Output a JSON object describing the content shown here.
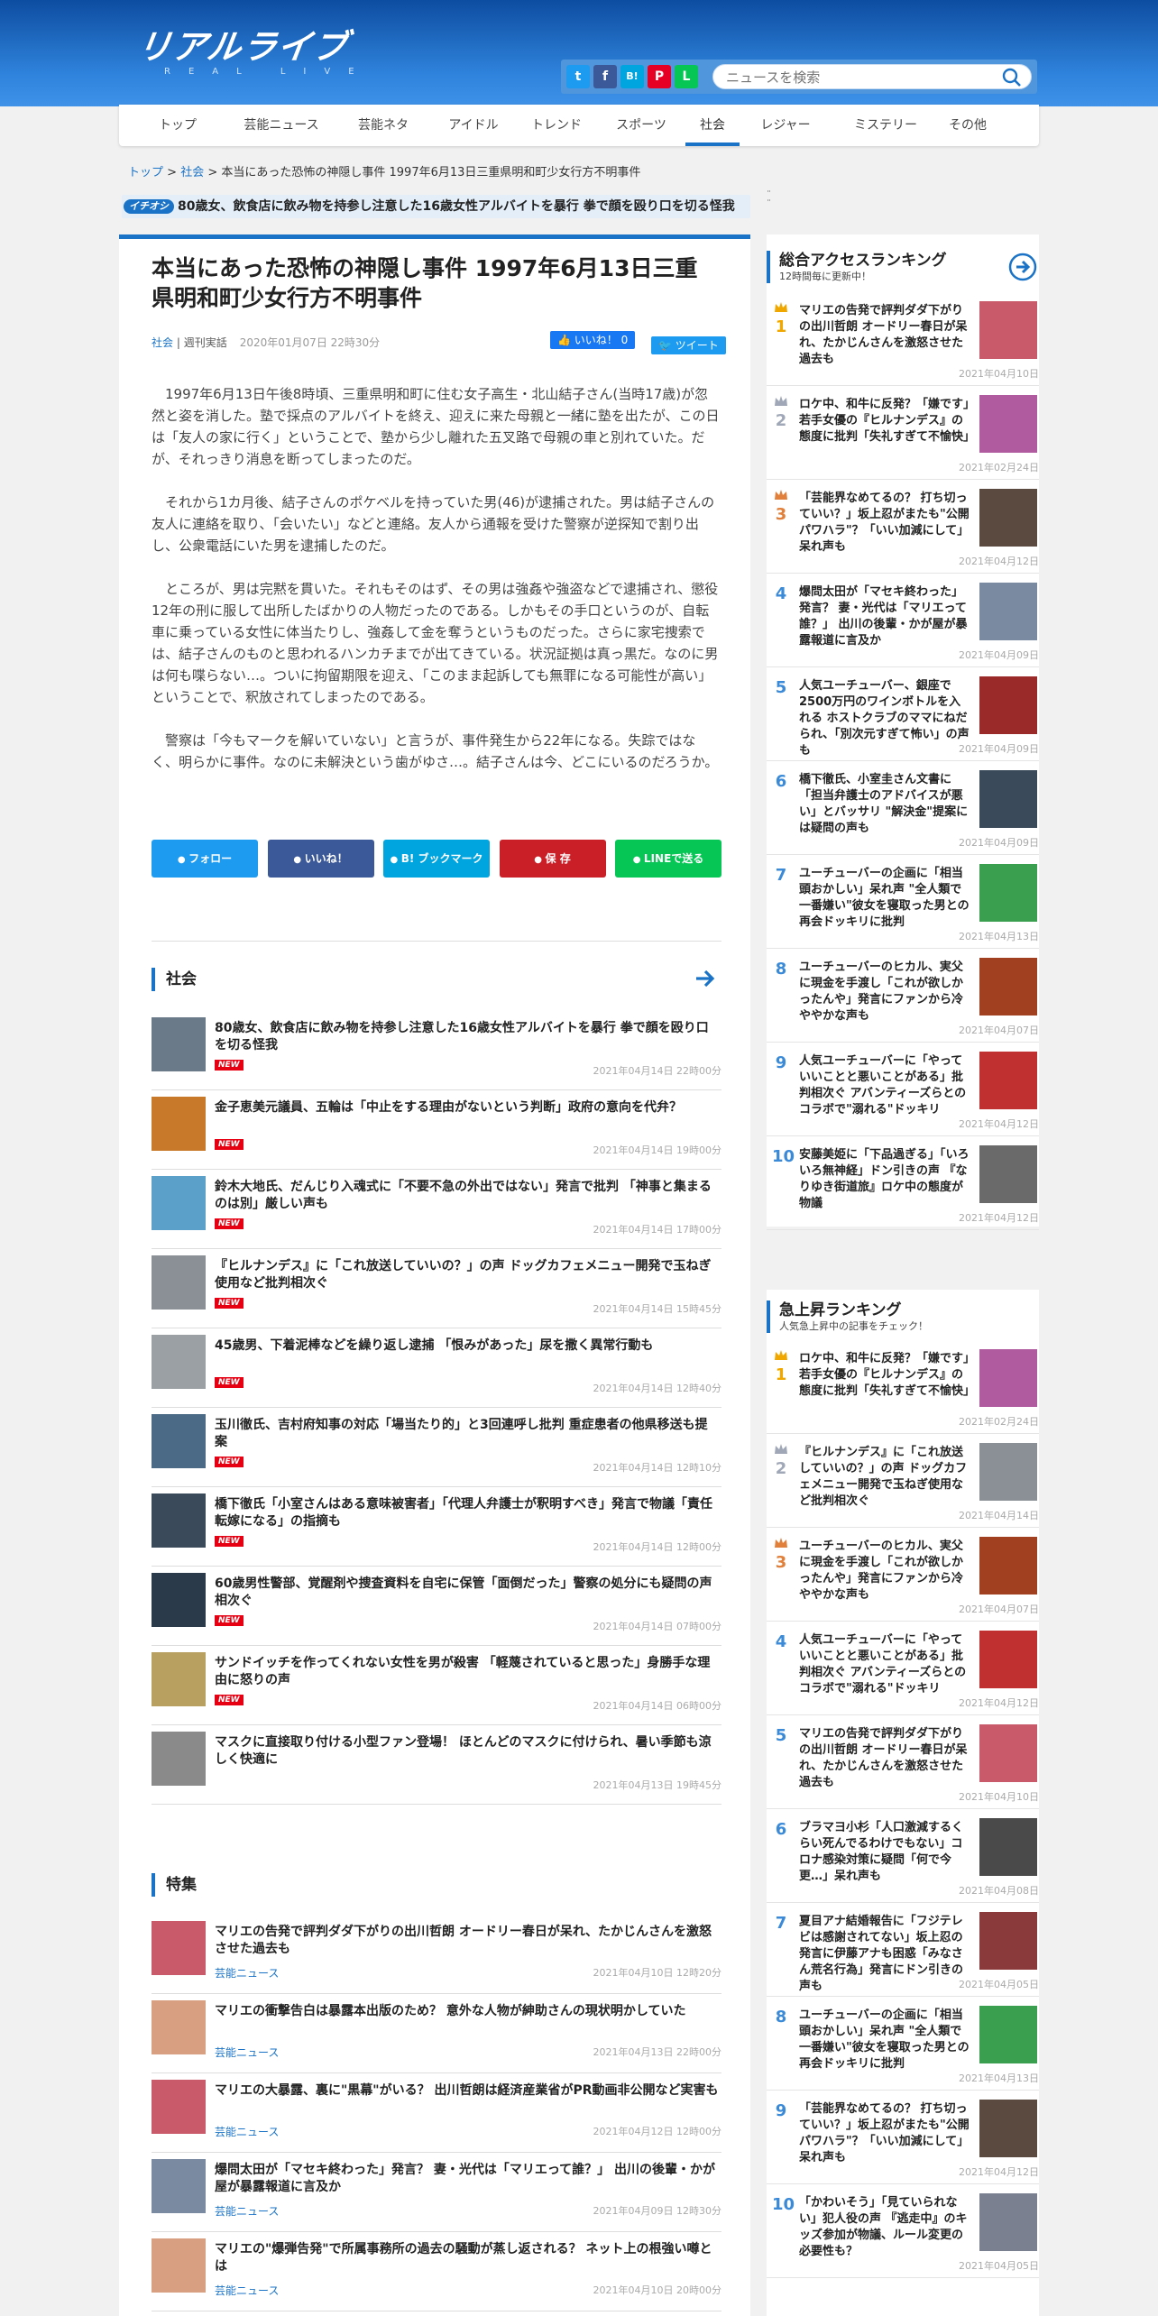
{
  "site": {
    "logo": "リアルライブ",
    "logo_sub": "REAL LIVE",
    "search_placeholder": "ニュースを検索"
  },
  "share_icons": [
    {
      "name": "twitter-icon",
      "glyph": "t",
      "color": "#1d9bf0"
    },
    {
      "name": "facebook-icon",
      "glyph": "f",
      "color": "#3b5998"
    },
    {
      "name": "hatena-icon",
      "glyph": "B!",
      "color": "#00a4de"
    },
    {
      "name": "pinterest-icon",
      "glyph": "P",
      "color": "#e60023"
    },
    {
      "name": "line-icon",
      "glyph": "L",
      "color": "#06c755"
    }
  ],
  "nav": [
    "トップ",
    "芸能ニュース",
    "芸能ネタ",
    "アイドル",
    "トレンド",
    "スポーツ",
    "社会",
    "レジャー",
    "ミステリー",
    "その他"
  ],
  "nav_active": "社会",
  "breadcrumb": {
    "home": "トップ",
    "sep": " > ",
    "cat": "社会",
    "current": "本当にあった恐怖の神隠し事件 1997年6月13日三重県明和町少女行方不明事件"
  },
  "pickup": {
    "tag": "イチオシ",
    "text": "80歳女、飲食店に飲み物を持参し注意した16歳女性アルバイトを暴行 拳で顔を殴り口を切る怪我",
    "dots": "¨"
  },
  "article": {
    "title": "本当にあった恐怖の神隠し事件 1997年6月13日三重県明和町少女行方不明事件",
    "category": "社会",
    "sep": "|",
    "author": "週刊実話",
    "date": "2020年01月07日 22時30分",
    "like": "いいね！ 0",
    "tweet": "ツイート",
    "paragraphs": [
      "1997年6月13日午後8時頃、三重県明和町に住む女子高生・北山結子さん(当時17歳)が忽然と姿を消した。塾で採点のアルバイトを終え、迎えに来た母親と一緒に塾を出たが、この日は「友人の家に行く」ということで、塾から少し離れた五叉路で母親の車と別れていた。だが、それっきり消息を断ってしまったのだ。",
      "それから1カ月後、結子さんのポケベルを持っていた男(46)が逮捕された。男は結子さんの友人に連絡を取り、「会いたい」などと連絡。友人から通報を受けた警察が逆探知で割り出し、公衆電話にいた男を逮捕したのだ。",
      "ところが、男は完黙を貫いた。それもそのはず、その男は強姦や強盗などで逮捕され、懲役12年の刑に服して出所したばかりの人物だったのである。しかもその手口というのが、自転車に乗っている女性に体当たりし、強姦して金を奪うというものだった。さらに家宅捜索では、結子さんのものと思われるハンカチまでが出てきている。状況証拠は真っ黒だ。なのに男は何も喋らない…。ついに拘留期限を迎え、「このまま起訴しても無罪になる可能性が高い」ということで、釈放されてしまったのである。",
      "警察は「今もマークを解いていない」と言うが、事件発生から22年になる。失踪ではなく、明らかに事件。なのに未解決という歯がゆさ…。結子さんは今、どこにいるのだろうか。"
    ]
  },
  "share_buttons": [
    {
      "label": "フォロー",
      "color": "#1d9bf0",
      "icon": "twitter-icon"
    },
    {
      "label": "いいね！",
      "color": "#3b5998",
      "icon": "like-icon"
    },
    {
      "label": "B! ブックマーク",
      "color": "#00a4de",
      "icon": "hatena-icon"
    },
    {
      "label": "保 存",
      "color": "#cb1f27",
      "icon": "pinterest-icon"
    },
    {
      "label": "LINEで送る",
      "color": "#06c755",
      "icon": "line-icon"
    }
  ],
  "section_social": {
    "title": "社会",
    "items": [
      {
        "title": "80歳女、飲食店に飲み物を持参し注意した16歳女性アルバイトを暴行 拳で顔を殴り口を切る怪我",
        "new": "NEW",
        "date": "2021年04月14日 22時00分",
        "c": "#6b7a88"
      },
      {
        "title": "金子恵美元議員、五輪は「中止をする理由がないという判断」政府の意向を代弁？",
        "new": "NEW",
        "date": "2021年04月14日 19時00分",
        "c": "#c87a2a"
      },
      {
        "title": "鈴木大地氏、だんじり入魂式に「不要不急の外出ではない」発言で批判 「神事と集まるのは別」厳しい声も",
        "new": "NEW",
        "date": "2021年04月14日 17時00分",
        "c": "#5aa0c8"
      },
      {
        "title": "『ヒルナンデス』に「これ放送していいの？」の声 ドッグカフェメニュー開発で玉ねぎ使用など批判相次ぐ",
        "new": "NEW",
        "date": "2021年04月14日 15時45分",
        "c": "#8a9096"
      },
      {
        "title": "45歳男、下着泥棒などを繰り返し逮捕 「恨みがあった」尿を撒く異常行動も",
        "new": "NEW",
        "date": "2021年04月14日 12時40分",
        "c": "#9aa0a4"
      },
      {
        "title": "玉川徹氏、吉村府知事の対応「場当たり的」と3回連呼し批判 重症患者の他県移送も提案",
        "new": "NEW",
        "date": "2021年04月14日 12時10分",
        "c": "#4a6a86"
      },
      {
        "title": "橋下徹氏「小室さんはある意味被害者」「代理人弁護士が釈明すべき」発言で物議「責任転嫁になる」の指摘も",
        "new": "NEW",
        "date": "2021年04月14日 12時00分",
        "c": "#3a4a5a"
      },
      {
        "title": "60歳男性警部、覚醒剤や捜査資料を自宅に保管「面倒だった」警察の処分にも疑問の声相次ぐ",
        "new": "NEW",
        "date": "2021年04月14日 07時00分",
        "c": "#2a3a4a"
      },
      {
        "title": "サンドイッチを作ってくれない女性を男が殺害 「軽蔑されていると思った」身勝手な理由に怒りの声",
        "new": "NEW",
        "date": "2021年04月14日 06時00分",
        "c": "#b8a060"
      },
      {
        "title": "マスクに直接取り付ける小型ファン登場！ ほとんどのマスクに付けられ、暑い季節も涼しく快適に",
        "new": "",
        "date": "2021年04月13日 19時45分",
        "c": "#8a8a8a"
      }
    ]
  },
  "section_feature": {
    "title": "特集",
    "items": [
      {
        "title": "マリエの告発で評判ダダ下がりの出川哲朗 オードリー春日が呆れ、たかじんさんを激怒させた過去も",
        "cat": "芸能ニュース",
        "date": "2021年04月10日 12時20分",
        "c": "#c85a6a"
      },
      {
        "title": "マリエの衝撃告白は暴露本出版のため？ 意外な人物が紳助さんの現状明かしていた",
        "cat": "芸能ニュース",
        "date": "2021年04月13日 22時00分",
        "c": "#d8a080"
      },
      {
        "title": "マリエの大暴露、裏に\"黒幕\"がいる？ 出川哲朗は経済産業省がPR動画非公開など実害も",
        "cat": "芸能ニュース",
        "date": "2021年04月12日 12時00分",
        "c": "#c85a6a"
      },
      {
        "title": "爆問太田が「マセキ終わった」発言？ 妻・光代は「マリエって誰？」 出川の後輩・かが屋が暴露報道に言及か",
        "cat": "芸能ニュース",
        "date": "2021年04月09日 12時30分",
        "c": "#7a8aa0"
      },
      {
        "title": "マリエの\"爆弾告発\"で所属事務所の過去の騒動が蒸し返される？ ネット上の根強い噂とは",
        "cat": "芸能ニュース",
        "date": "2021年04月10日 20時00分",
        "c": "#d8a080"
      }
    ]
  },
  "ranking_total": {
    "title": "総合アクセスランキング",
    "sub": "12時間毎に更新中！",
    "items": [
      {
        "rank": "1",
        "title": "マリエの告発で評判ダダ下がりの出川哲朗 オードリー春日が呆れ、たかじんさんを激怒させた過去も",
        "date": "2021年04月10日",
        "c": "#c85a6a"
      },
      {
        "rank": "2",
        "title": "ロケ中、和牛に反発？「嫌です」若手女優の『ヒルナンデス』の態度に批判「失礼すぎて不愉快」",
        "date": "2021年02月24日",
        "c": "#b05aa0"
      },
      {
        "rank": "3",
        "title": "「芸能界なめてるの？ 打ち切っていい？」坂上忍がまたも\"公開パワハラ\"？「いい加減にして」呆れ声も",
        "date": "2021年04月12日",
        "c": "#5a4a40"
      },
      {
        "rank": "4",
        "title": "爆問太田が「マセキ終わった」発言？ 妻・光代は「マリエって誰？」 出川の後輩・かが屋が暴露報道に言及か",
        "date": "2021年04月09日",
        "c": "#7a8aa0"
      },
      {
        "rank": "5",
        "title": "人気ユーチューバー、銀座で2500万円のワインボトルを入れる ホストクラブのママにねだられ、「別次元すぎて怖い」の声も",
        "date": "2021年04月09日",
        "c": "#9a2a2a"
      },
      {
        "rank": "6",
        "title": "橋下徹氏、小室圭さん文書に「担当弁護士のアドバイスが悪い」とバッサリ \"解決金\"提案には疑問の声も",
        "date": "2021年04月09日",
        "c": "#3a4a5a"
      },
      {
        "rank": "7",
        "title": "ユーチューバーの企画に「相当頭おかしい」呆れ声 \"全人類で一番嫌い\"彼女を寝取った男との再会ドッキリに批判",
        "date": "2021年04月13日",
        "c": "#3aa050"
      },
      {
        "rank": "8",
        "title": "ユーチューバーのヒカル、実父に現金を手渡し「これが欲しかったんや」発言にファンから冷ややかな声も",
        "date": "2021年04月07日",
        "c": "#a04020"
      },
      {
        "rank": "9",
        "title": "人気ユーチューバーに「やっていいことと悪いことがある」批判相次ぐ アバンティーズらとのコラボで\"溺れる\"ドッキリ",
        "date": "2021年04月12日",
        "c": "#c03030"
      },
      {
        "rank": "10",
        "title": "安藤美姫に「下品過ぎる」「いろいろ無神経」ドン引きの声 『なりゆき街道旅』ロケ中の態度が物議",
        "date": "2021年04月12日",
        "c": "#6a6a6a"
      }
    ]
  },
  "ranking_rising": {
    "title": "急上昇ランキング",
    "sub": "人気急上昇中の記事をチェック！",
    "items": [
      {
        "rank": "1",
        "title": "ロケ中、和牛に反発？「嫌です」若手女優の『ヒルナンデス』の態度に批判「失礼すぎて不愉快」",
        "date": "2021年02月24日",
        "c": "#b05aa0"
      },
      {
        "rank": "2",
        "title": "『ヒルナンデス』に「これ放送していいの？」の声 ドッグカフェメニュー開発で玉ねぎ使用など批判相次ぐ",
        "date": "2021年04月14日",
        "c": "#8a9096"
      },
      {
        "rank": "3",
        "title": "ユーチューバーのヒカル、実父に現金を手渡し「これが欲しかったんや」発言にファンから冷ややかな声も",
        "date": "2021年04月07日",
        "c": "#a04020"
      },
      {
        "rank": "4",
        "title": "人気ユーチューバーに「やっていいことと悪いことがある」批判相次ぐ アバンティーズらとのコラボで\"溺れる\"ドッキリ",
        "date": "2021年04月12日",
        "c": "#c03030"
      },
      {
        "rank": "5",
        "title": "マリエの告発で評判ダダ下がりの出川哲朗 オードリー春日が呆れ、たかじんさんを激怒させた過去も",
        "date": "2021年04月10日",
        "c": "#c85a6a"
      },
      {
        "rank": "6",
        "title": "ブラマヨ小杉「人口激減するくらい死んでるわけでもない」コロナ感染対策に疑問「何で今更…」呆れ声も",
        "date": "2021年04月08日",
        "c": "#4a4a4a"
      },
      {
        "rank": "7",
        "title": "夏目アナ結婚報告に「フジテレビは感謝されてない」坂上忍の発言に伊藤アナも困惑「みなさん荒名行為」発言にドン引きの声も",
        "date": "2021年04月05日",
        "c": "#8a3a3a"
      },
      {
        "rank": "8",
        "title": "ユーチューバーの企画に「相当頭おかしい」呆れ声 \"全人類で一番嫌い\"彼女を寝取った男との再会ドッキリに批判",
        "date": "2021年04月13日",
        "c": "#3aa050"
      },
      {
        "rank": "9",
        "title": "「芸能界なめてるの？ 打ち切っていい？」坂上忍がまたも\"公開パワハラ\"？「いい加減にして」呆れ声も",
        "date": "2021年04月12日",
        "c": "#5a4a40"
      },
      {
        "rank": "10",
        "title": "「かわいそう」「見ていられない」犯人役の声 『逃走中』のキッズ参加が物議、ルール変更の必要性も？",
        "date": "2021年04月05日",
        "c": "#7a8090"
      }
    ]
  }
}
